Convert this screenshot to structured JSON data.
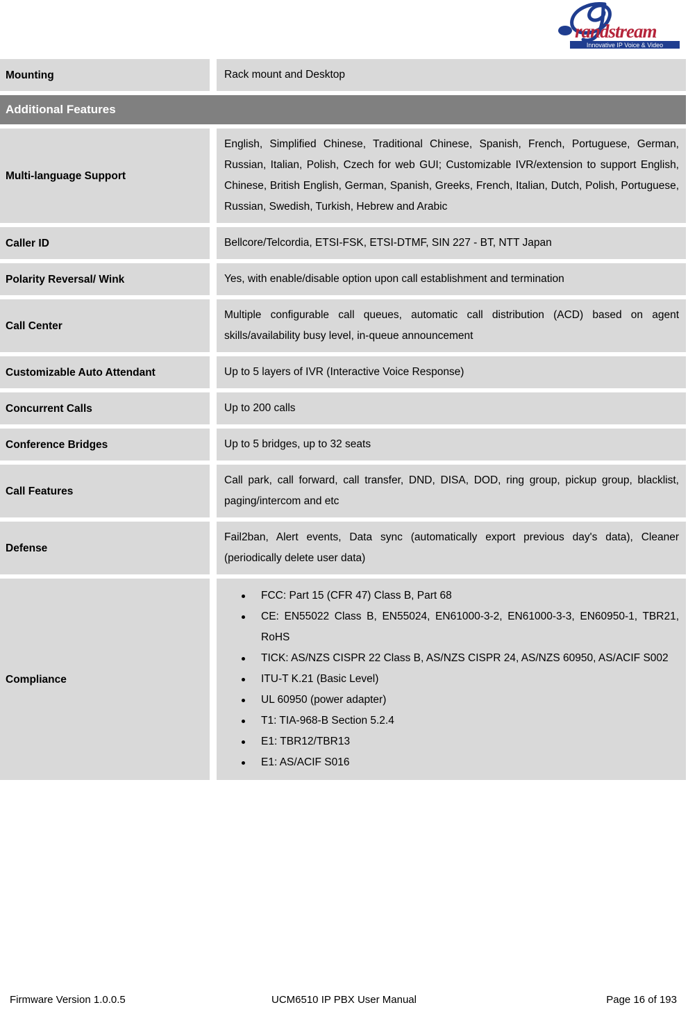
{
  "header": {
    "logo_name": "Grandstream",
    "logo_tagline": "Innovative IP Voice & Video"
  },
  "table": {
    "rows": [
      {
        "type": "data",
        "label": "Mounting",
        "value": "Rack mount and Desktop"
      },
      {
        "type": "section",
        "label": "Additional Features"
      },
      {
        "type": "data",
        "label": "Multi-language Support",
        "value": "English, Simplified Chinese, Traditional Chinese, Spanish, French, Portuguese, German, Russian, Italian, Polish, Czech for web GUI; Customizable IVR/extension to support English, Chinese, British English, German, Spanish, Greeks, French, Italian, Dutch, Polish, Portuguese, Russian, Swedish, Turkish, Hebrew and Arabic"
      },
      {
        "type": "data",
        "label": "Caller ID",
        "value": "Bellcore/Telcordia, ETSI-FSK, ETSI-DTMF, SIN 227 - BT, NTT Japan"
      },
      {
        "type": "data",
        "label": "Polarity Reversal/ Wink",
        "value": "Yes, with enable/disable option upon call establishment and termination"
      },
      {
        "type": "data",
        "label": "Call Center",
        "value": "Multiple configurable call queues, automatic call distribution (ACD) based on agent skills/availability busy level, in-queue announcement"
      },
      {
        "type": "data",
        "label": "Customizable Auto Attendant",
        "value": "Up to 5 layers of IVR (Interactive Voice Response)"
      },
      {
        "type": "data",
        "label": "Concurrent Calls",
        "value": "Up to 200 calls"
      },
      {
        "type": "data",
        "label": "Conference Bridges",
        "value": "Up to 5 bridges, up to 32 seats"
      },
      {
        "type": "data",
        "label": "Call Features",
        "value": "Call park, call forward, call transfer, DND, DISA, DOD, ring group, pickup group, blacklist, paging/intercom and etc"
      },
      {
        "type": "data",
        "label": "Defense",
        "value": "Fail2ban, Alert events, Data sync (automatically export previous day's data), Cleaner (periodically delete user data)"
      },
      {
        "type": "bullets",
        "label": "Compliance",
        "items": [
          "FCC: Part 15 (CFR 47) Class B, Part 68",
          "CE: EN55022 Class B, EN55024, EN61000-3-2, EN61000-3-3, EN60950-1, TBR21, RoHS",
          "TICK: AS/NZS CISPR 22 Class B, AS/NZS CISPR 24, AS/NZS 60950, AS/ACIF S002",
          "ITU-T K.21 (Basic Level)",
          "UL 60950 (power adapter)",
          "T1: TIA-968-B Section 5.2.4",
          "E1: TBR12/TBR13",
          "E1: AS/ACIF S016"
        ]
      }
    ]
  },
  "footer": {
    "left": "Firmware Version 1.0.0.5",
    "center": "UCM6510 IP PBX User Manual",
    "right": "Page 16 of 193"
  },
  "colors": {
    "cell_background": "#d9d9d9",
    "section_background": "#808080",
    "section_text": "#ffffff",
    "logo_blue": "#1f3d8f",
    "logo_red": "#b5243a",
    "page_background": "#ffffff"
  }
}
